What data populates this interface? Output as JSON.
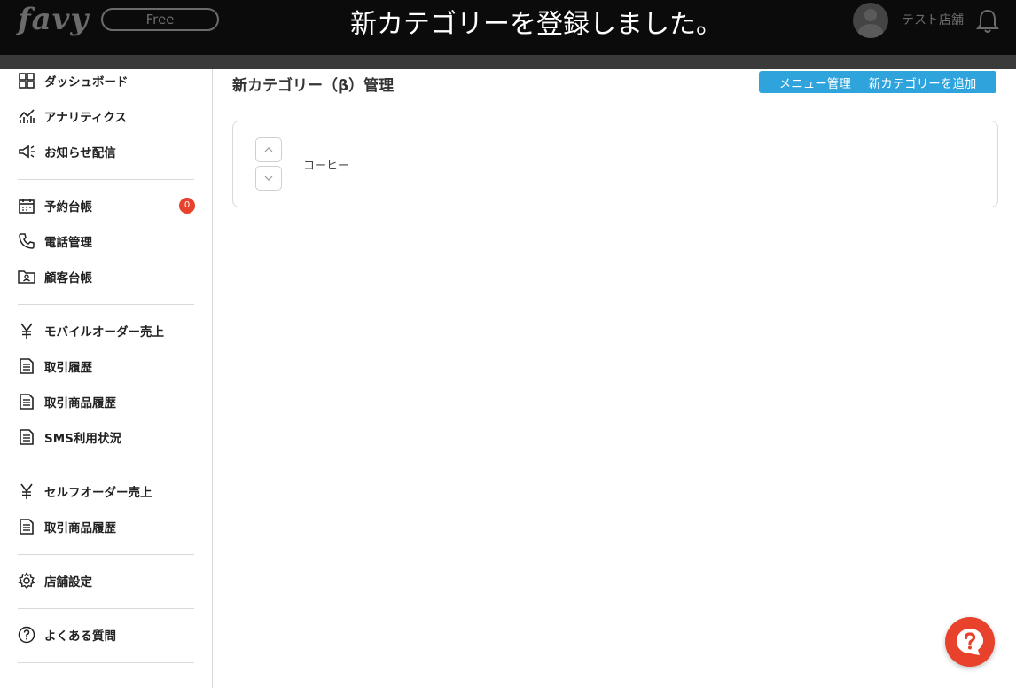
{
  "header": {
    "logo": "favy",
    "plan": "Free",
    "toast": "新カテゴリーを登録しました。",
    "store_name": "テスト店舗"
  },
  "sidebar": {
    "items": [
      {
        "label": "ダッシュボード",
        "icon": "dashboard-icon"
      },
      {
        "label": "アナリティクス",
        "icon": "analytics-icon"
      },
      {
        "label": "お知らせ配信",
        "icon": "megaphone-icon"
      },
      {
        "label": "予約台帳",
        "icon": "calendar-icon",
        "badge": "0"
      },
      {
        "label": "電話管理",
        "icon": "phone-icon"
      },
      {
        "label": "顧客台帳",
        "icon": "customer-folder-icon"
      },
      {
        "label": "モバイルオーダー売上",
        "icon": "yen-icon"
      },
      {
        "label": "取引履歴",
        "icon": "document-icon"
      },
      {
        "label": "取引商品履歴",
        "icon": "document-icon"
      },
      {
        "label": "SMS利用状況",
        "icon": "document-icon"
      },
      {
        "label": "セルフオーダー売上",
        "icon": "yen-icon"
      },
      {
        "label": "取引商品履歴",
        "icon": "document-icon"
      },
      {
        "label": "店舗設定",
        "icon": "gear-icon"
      },
      {
        "label": "よくある質問",
        "icon": "question-icon"
      }
    ]
  },
  "main": {
    "title": "新カテゴリー（β）管理",
    "menu_manage_label": "メニュー管理",
    "add_category_label": "新カテゴリーを追加",
    "categories": [
      {
        "name": "コーヒー"
      }
    ]
  },
  "colors": {
    "accent": "#2ea3dc",
    "badge": "#e8412c",
    "header_bg": "#0b0b0b"
  }
}
